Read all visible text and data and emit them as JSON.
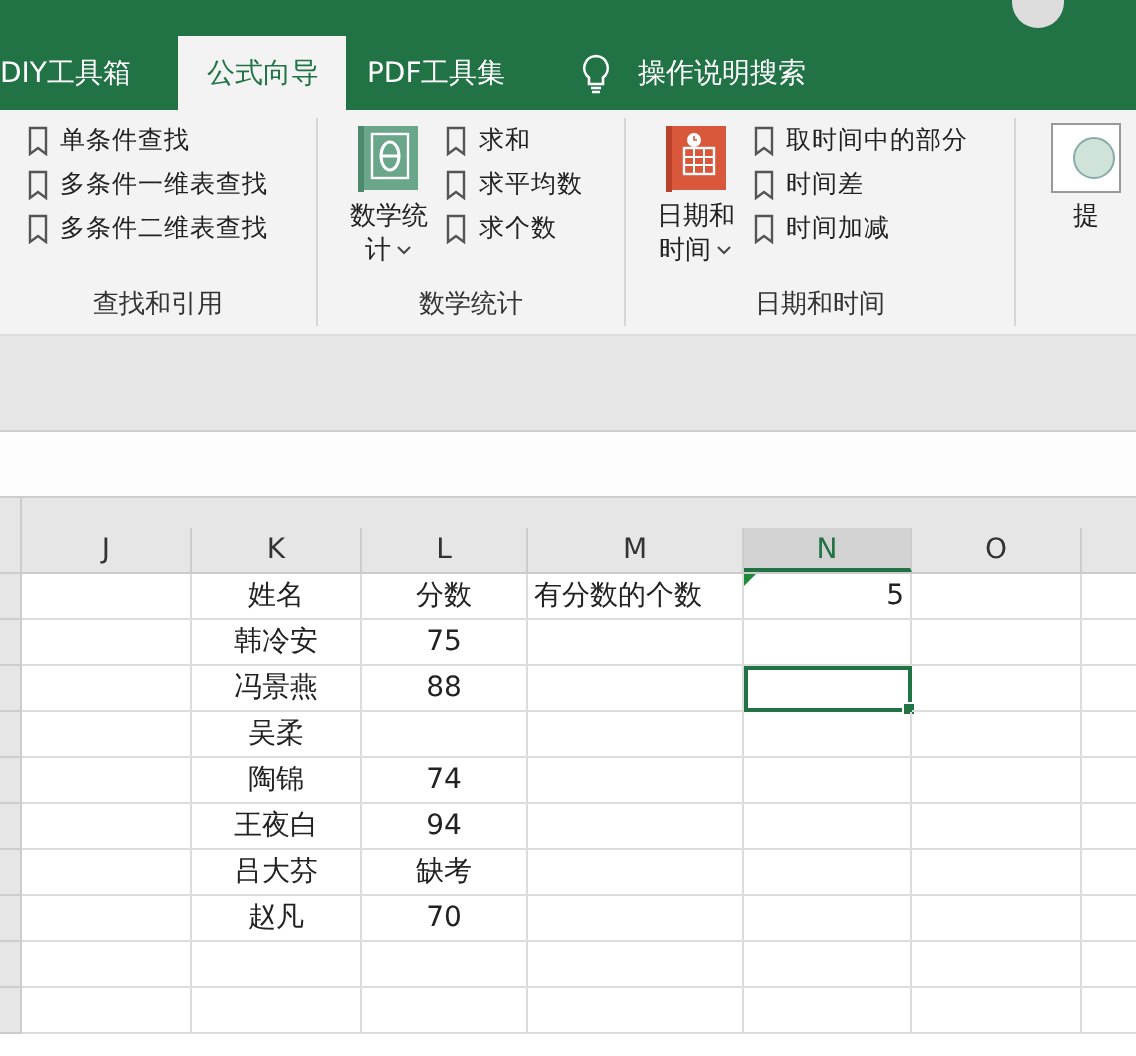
{
  "tabs": [
    {
      "label": "DIY工具箱",
      "selected": false
    },
    {
      "label": "公式向导",
      "selected": true
    },
    {
      "label": "PDF工具集",
      "selected": false
    }
  ],
  "search": {
    "label": "操作说明搜索"
  },
  "groups": [
    {
      "label": "查找和引用",
      "items": [
        "单条件查找",
        "多条件一维表查找",
        "多条件二维表查找"
      ]
    },
    {
      "label": "数学统计",
      "big": {
        "label": "数学统计",
        "kind": "math"
      },
      "items": [
        "求和",
        "求平均数",
        "求个数"
      ]
    },
    {
      "label": "日期和时间",
      "big": {
        "label": "日期和时间",
        "kind": "calendar"
      },
      "items": [
        "取时间中的部分",
        "时间差",
        "时间加减"
      ]
    },
    {
      "big": {
        "label": "提",
        "kind": "blank"
      }
    }
  ],
  "columns": [
    {
      "label": "J",
      "selected": false
    },
    {
      "label": "K",
      "selected": false
    },
    {
      "label": "L",
      "selected": false
    },
    {
      "label": "M",
      "selected": false
    },
    {
      "label": "N",
      "selected": true
    },
    {
      "label": "O",
      "selected": false
    }
  ],
  "rows": [
    [
      {
        "selected": false
      },
      {
        "text": "姓名",
        "selected": false
      },
      {
        "text": "分数",
        "selected": false
      },
      {
        "text": "有分数的个数",
        "selected": false
      },
      {
        "text": "5",
        "flagged": true,
        "selected": false
      },
      {
        "selected": false
      }
    ],
    [
      {
        "selected": false
      },
      {
        "text": "韩冷安",
        "selected": false
      },
      {
        "text": "75",
        "selected": false
      },
      {
        "selected": false
      },
      {
        "selected": false
      },
      {
        "selected": false
      }
    ],
    [
      {
        "selected": false
      },
      {
        "text": "冯景燕",
        "selected": false
      },
      {
        "text": "88",
        "selected": false
      },
      {
        "selected": false
      },
      {
        "selected": true
      },
      {
        "selected": false
      }
    ],
    [
      {
        "selected": false
      },
      {
        "text": "吴柔",
        "selected": false
      },
      {
        "selected": false
      },
      {
        "selected": false
      },
      {
        "selected": false
      },
      {
        "selected": false
      }
    ],
    [
      {
        "selected": false
      },
      {
        "text": "陶锦",
        "selected": false
      },
      {
        "text": "74",
        "selected": false
      },
      {
        "selected": false
      },
      {
        "selected": false
      },
      {
        "selected": false
      }
    ],
    [
      {
        "selected": false
      },
      {
        "text": "王夜白",
        "selected": false
      },
      {
        "text": "94",
        "selected": false
      },
      {
        "selected": false
      },
      {
        "selected": false
      },
      {
        "selected": false
      }
    ],
    [
      {
        "selected": false
      },
      {
        "text": "吕大芬",
        "selected": false
      },
      {
        "text": "缺考",
        "selected": false
      },
      {
        "selected": false
      },
      {
        "selected": false
      },
      {
        "selected": false
      }
    ],
    [
      {
        "selected": false
      },
      {
        "text": "赵凡",
        "selected": false
      },
      {
        "text": "70",
        "selected": false
      },
      {
        "selected": false
      },
      {
        "selected": false
      },
      {
        "selected": false
      }
    ],
    [
      {
        "selected": false
      },
      {
        "selected": false
      },
      {
        "selected": false
      },
      {
        "selected": false
      },
      {
        "selected": false
      },
      {
        "selected": false
      }
    ],
    [
      {
        "selected": false
      },
      {
        "selected": false
      },
      {
        "selected": false
      },
      {
        "selected": false
      },
      {
        "selected": false
      },
      {
        "selected": false
      }
    ]
  ]
}
